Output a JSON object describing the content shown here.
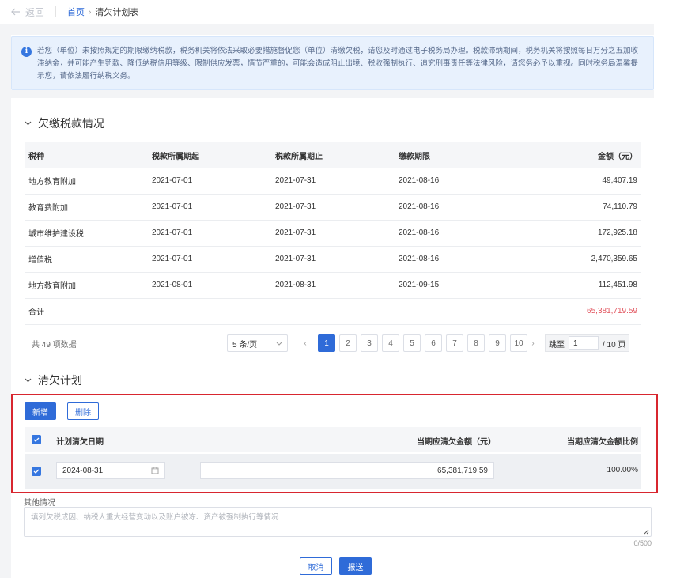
{
  "topbar": {
    "back_label": "返回",
    "breadcrumb_home": "首页",
    "breadcrumb_current": "清欠计划表"
  },
  "notice": {
    "text": "若您（单位）未按照规定的期限缴纳税款，税务机关将依法采取必要措施督促您（单位）清缴欠税，请您及时通过电子税务局办理。税款滞纳期间，税务机关将按照每日万分之五加收滞纳金，并可能产生罚款、降低纳税信用等级、限制供应发票，情节严重的，可能会造成阻止出境、税收强制执行、追究刑事责任等法律风险，请您务必予以重视。同时税务局温馨提示您，请依法履行纳税义务。"
  },
  "arrears": {
    "title": "欠缴税款情况",
    "columns": [
      "税种",
      "税款所属期起",
      "税款所属期止",
      "缴款期限",
      "金额（元）"
    ],
    "rows": [
      [
        "地方教育附加",
        "2021-07-01",
        "2021-07-31",
        "2021-08-16",
        "49,407.19"
      ],
      [
        "教育费附加",
        "2021-07-01",
        "2021-07-31",
        "2021-08-16",
        "74,110.79"
      ],
      [
        "城市维护建设税",
        "2021-07-01",
        "2021-07-31",
        "2021-08-16",
        "172,925.18"
      ],
      [
        "增值税",
        "2021-07-01",
        "2021-07-31",
        "2021-08-16",
        "2,470,359.65"
      ],
      [
        "地方教育附加",
        "2021-08-01",
        "2021-08-31",
        "2021-09-15",
        "112,451.98"
      ]
    ],
    "total_label": "合计",
    "total_value": "65,381,719.59"
  },
  "pagination": {
    "total_text": "共 49 项数据",
    "page_size": "5 条/页",
    "prev": "‹",
    "next": "›",
    "pages": [
      "1",
      "2",
      "3",
      "4",
      "5",
      "6",
      "7",
      "8",
      "9",
      "10"
    ],
    "current_page": "1",
    "jump_label": "跳至",
    "jump_value": "1",
    "jump_total": "/ 10 页"
  },
  "plan": {
    "title": "清欠计划",
    "add_label": "新增",
    "delete_label": "删除",
    "col_date": "计划清欠日期",
    "col_amount": "当期应清欠金额（元）",
    "col_ratio": "当期应清欠金额比例",
    "row": {
      "date": "2024-08-31",
      "amount": "65,381,719.59",
      "ratio": "100.00%"
    }
  },
  "other": {
    "label": "其他情况",
    "placeholder": "填列欠税成因、纳税人重大经营变动以及账户被冻、资产被强制执行等情况",
    "counter": "0/500"
  },
  "footer": {
    "cancel_label": "取消",
    "submit_label": "报送"
  },
  "colors": {
    "primary": "#2f6bd8",
    "highlight_border": "#d8262f",
    "total_red": "#e2555f",
    "notice_bg": "#e8f1fd"
  }
}
